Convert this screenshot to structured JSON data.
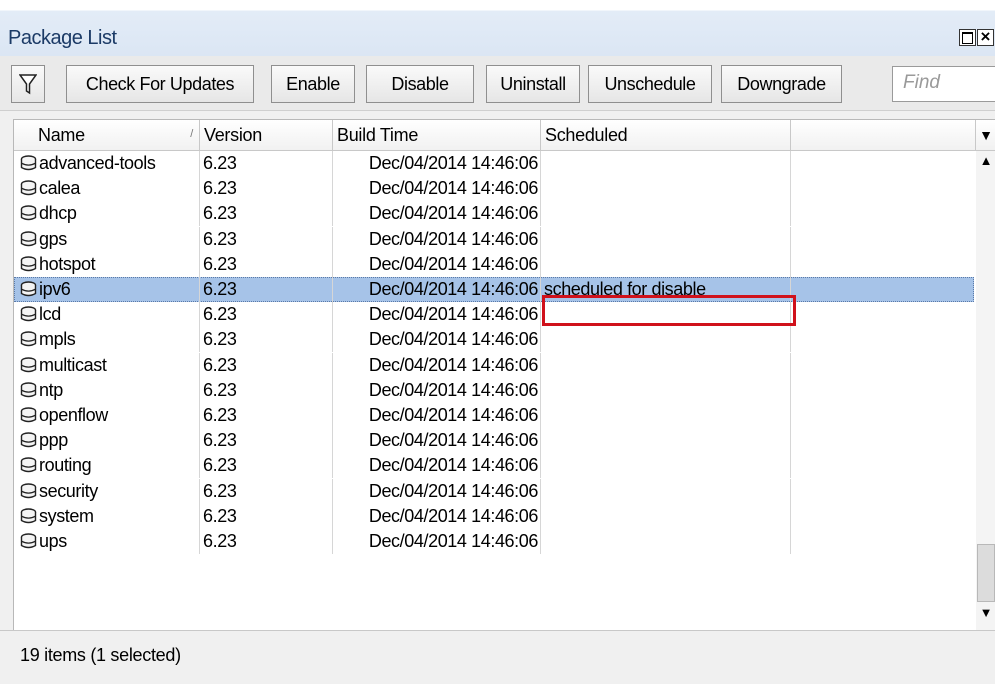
{
  "window": {
    "title": "Package List"
  },
  "toolbar": {
    "filter_icon": "filter-icon",
    "buttons": [
      "Check For Updates",
      "Enable",
      "Disable",
      "Uninstall",
      "Unschedule",
      "Downgrade"
    ],
    "find_placeholder": "Find"
  },
  "table": {
    "columns": [
      "Name",
      "Version",
      "Build Time",
      "Scheduled",
      ""
    ],
    "rows": [
      {
        "name": "advanced-tools",
        "version": "6.23",
        "build_time": "Dec/04/2014 14:46:06",
        "scheduled": ""
      },
      {
        "name": "calea",
        "version": "6.23",
        "build_time": "Dec/04/2014 14:46:06",
        "scheduled": ""
      },
      {
        "name": "dhcp",
        "version": "6.23",
        "build_time": "Dec/04/2014 14:46:06",
        "scheduled": ""
      },
      {
        "name": "gps",
        "version": "6.23",
        "build_time": "Dec/04/2014 14:46:06",
        "scheduled": ""
      },
      {
        "name": "hotspot",
        "version": "6.23",
        "build_time": "Dec/04/2014 14:46:06",
        "scheduled": ""
      },
      {
        "name": "ipv6",
        "version": "6.23",
        "build_time": "Dec/04/2014 14:46:06",
        "scheduled": "scheduled for disable",
        "selected": true
      },
      {
        "name": "lcd",
        "version": "6.23",
        "build_time": "Dec/04/2014 14:46:06",
        "scheduled": ""
      },
      {
        "name": "mpls",
        "version": "6.23",
        "build_time": "Dec/04/2014 14:46:06",
        "scheduled": ""
      },
      {
        "name": "multicast",
        "version": "6.23",
        "build_time": "Dec/04/2014 14:46:06",
        "scheduled": ""
      },
      {
        "name": "ntp",
        "version": "6.23",
        "build_time": "Dec/04/2014 14:46:06",
        "scheduled": ""
      },
      {
        "name": "openflow",
        "version": "6.23",
        "build_time": "Dec/04/2014 14:46:06",
        "scheduled": ""
      },
      {
        "name": "ppp",
        "version": "6.23",
        "build_time": "Dec/04/2014 14:46:06",
        "scheduled": ""
      },
      {
        "name": "routing",
        "version": "6.23",
        "build_time": "Dec/04/2014 14:46:06",
        "scheduled": ""
      },
      {
        "name": "security",
        "version": "6.23",
        "build_time": "Dec/04/2014 14:46:06",
        "scheduled": ""
      },
      {
        "name": "system",
        "version": "6.23",
        "build_time": "Dec/04/2014 14:46:06",
        "scheduled": ""
      },
      {
        "name": "ups",
        "version": "6.23",
        "build_time": "Dec/04/2014 14:46:06",
        "scheduled": ""
      }
    ]
  },
  "status": {
    "text": "19 items (1 selected)"
  },
  "colors": {
    "selection": "#a6c3e8",
    "highlight_box": "#d0111b"
  }
}
